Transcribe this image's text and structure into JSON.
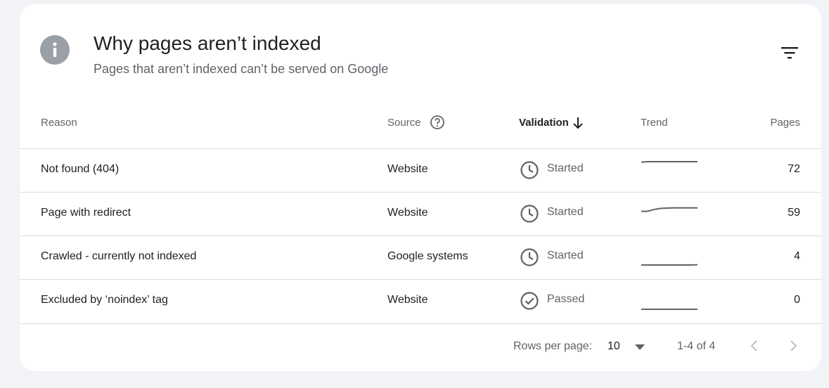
{
  "header": {
    "title": "Why pages aren’t indexed",
    "subtitle": "Pages that aren’t indexed can’t be served on Google"
  },
  "columns": {
    "reason": "Reason",
    "source": "Source",
    "validation": "Validation",
    "trend": "Trend",
    "pages": "Pages"
  },
  "rows": [
    {
      "reason": "Not found (404)",
      "source": "Website",
      "validation": "Started",
      "pages": "72",
      "trend": [
        68,
        70,
        70,
        70,
        70,
        70,
        70,
        70,
        70,
        70
      ]
    },
    {
      "reason": "Page with redirect",
      "source": "Website",
      "validation": "Started",
      "pages": "59",
      "trend": [
        45,
        45,
        52,
        57,
        58,
        59,
        59,
        59,
        59,
        59
      ]
    },
    {
      "reason": "Crawled - currently not indexed",
      "source": "Google systems",
      "validation": "Started",
      "pages": "4",
      "trend": [
        3,
        3,
        3,
        3,
        3,
        3,
        3,
        3,
        3,
        4
      ]
    },
    {
      "reason": "Excluded by ‘noindex’ tag",
      "source": "Website",
      "validation": "Passed",
      "pages": "0",
      "trend": [
        0,
        0,
        0,
        0,
        0,
        0,
        0,
        0,
        0,
        0
      ]
    }
  ],
  "footer": {
    "rows_per_page_label": "Rows per page:",
    "rows_per_page_value": "10",
    "range": "1-4 of 4"
  },
  "colors": {
    "accent_icon": "#9aa0a6",
    "status_icon": "#5f6368",
    "spark": "#5f6368"
  },
  "icons": [
    "info-icon",
    "filter-icon",
    "help-icon",
    "arrow-down-icon",
    "clock-icon",
    "check-circle-icon",
    "dropdown-icon",
    "chevron-left-icon",
    "chevron-right-icon"
  ]
}
